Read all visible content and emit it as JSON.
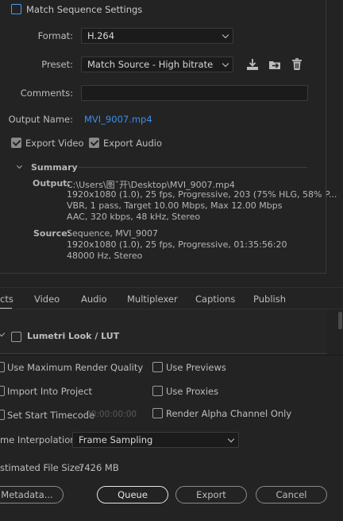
{
  "match_sequence": {
    "label": "Match Sequence Settings"
  },
  "format": {
    "label": "Format:",
    "value": "H.264"
  },
  "preset": {
    "label": "Preset:",
    "value": "Match Source - High bitrate"
  },
  "comments": {
    "label": "Comments:",
    "value": ""
  },
  "output_name": {
    "label": "Output Name:",
    "value": "MVI_9007.mp4"
  },
  "export_video": {
    "label": "Export Video",
    "checked": true
  },
  "export_audio": {
    "label": "Export Audio",
    "checked": true
  },
  "summary": {
    "title": "Summary",
    "output_key": "Output:",
    "output_lines": [
      "C:\\Users\\图ˇ开\\Desktop\\MVI_9007.mp4",
      "1920x1080 (1.0), 25 fps, Progressive, 203 (75% HLG, 58% P...",
      "VBR, 1 pass, Target 10.00 Mbps, Max 12.00 Mbps",
      "AAC, 320 kbps, 48 kHz, Stereo"
    ],
    "source_key": "Source:",
    "source_lines": [
      "Sequence, MVI_9007",
      "1920x1080 (1.0), 25 fps, Progressive, 01:35:56:20",
      "48000 Hz, Stereo"
    ]
  },
  "tabs": [
    "cts",
    "Video",
    "Audio",
    "Multiplexer",
    "Captions",
    "Publish"
  ],
  "lumetri": {
    "label": "Lumetri Look / LUT"
  },
  "options": {
    "max_render_quality": "Use Maximum Render Quality",
    "use_previews": "Use Previews",
    "import_into_project": "Import Into Project",
    "use_proxies": "Use Proxies",
    "set_start_timecode": "Set Start Timecode",
    "timecode_value": "00:00:00:00",
    "render_alpha": "Render Alpha Channel Only"
  },
  "interpolation": {
    "label": "me Interpolation:",
    "value": "Frame Sampling"
  },
  "file_size": {
    "label": "stimated File Size:",
    "value": "7426 MB"
  },
  "buttons": {
    "metadata": "Metadata...",
    "queue": "Queue",
    "export": "Export",
    "cancel": "Cancel"
  },
  "icons": [
    "save-preset-icon",
    "import-preset-icon",
    "delete-preset-icon",
    "chevron-down-icon"
  ]
}
